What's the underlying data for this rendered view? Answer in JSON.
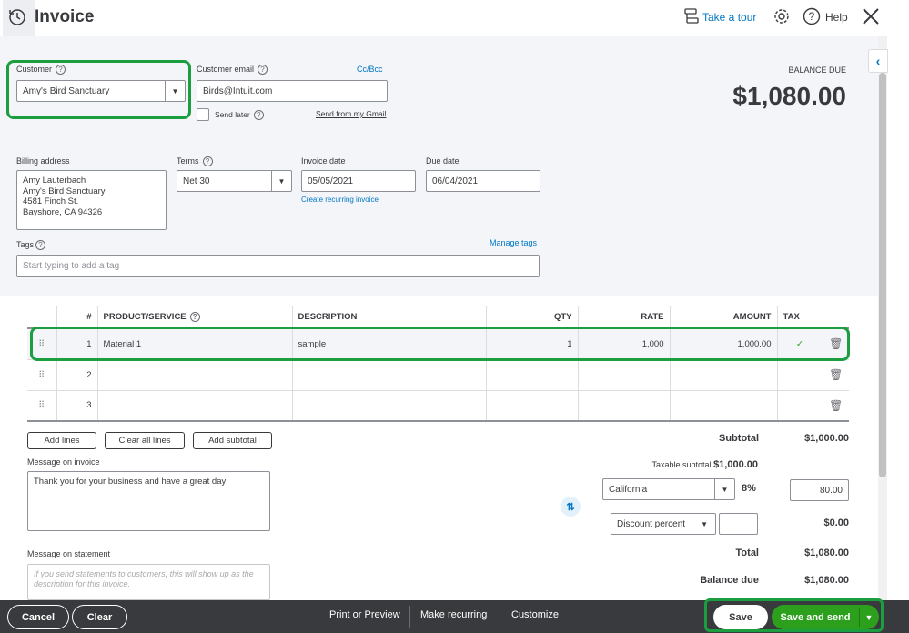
{
  "header": {
    "title": "Invoice",
    "take_a_tour": "Take a tour",
    "help": "Help"
  },
  "customer": {
    "label": "Customer",
    "value": "Amy's Bird Sanctuary",
    "email_label": "Customer email",
    "email_value": "Birds@Intuit.com",
    "ccbcc": "Cc/Bcc",
    "send_later": "Send later",
    "send_gmail": "Send from my Gmail"
  },
  "balance": {
    "label": "BALANCE DUE",
    "amount": "$1,080.00"
  },
  "billing": {
    "label": "Billing address",
    "lines": [
      "Amy Lauterbach",
      "Amy's Bird Sanctuary",
      "4581 Finch St.",
      "Bayshore, CA  94326"
    ]
  },
  "terms": {
    "label": "Terms",
    "value": "Net 30"
  },
  "invoice_date": {
    "label": "Invoice date",
    "value": "05/05/2021",
    "recurring_link": "Create recurring invoice"
  },
  "due_date": {
    "label": "Due date",
    "value": "06/04/2021"
  },
  "tags": {
    "label": "Tags",
    "manage": "Manage tags",
    "placeholder": "Start typing to add a tag"
  },
  "table": {
    "headers": {
      "num": "#",
      "product": "PRODUCT/SERVICE",
      "description": "DESCRIPTION",
      "qty": "QTY",
      "rate": "RATE",
      "amount": "AMOUNT",
      "tax": "TAX"
    },
    "rows": [
      {
        "num": "1",
        "product": "Material 1",
        "description": "sample",
        "qty": "1",
        "rate": "1,000",
        "amount": "1,000.00",
        "tax": "✓"
      },
      {
        "num": "2",
        "product": "",
        "description": "",
        "qty": "",
        "rate": "",
        "amount": "",
        "tax": ""
      },
      {
        "num": "3",
        "product": "",
        "description": "",
        "qty": "",
        "rate": "",
        "amount": "",
        "tax": ""
      }
    ]
  },
  "line_buttons": {
    "add_lines": "Add lines",
    "clear_all": "Clear all lines",
    "add_subtotal": "Add subtotal"
  },
  "message_invoice": {
    "label": "Message on invoice",
    "value": "Thank you for your business and have a great day!"
  },
  "message_statement": {
    "label": "Message on statement",
    "placeholder": "If you send statements to customers, this will show up as the description for this invoice."
  },
  "totals": {
    "subtotal_label": "Subtotal",
    "subtotal_value": "$1,000.00",
    "taxable_label": "Taxable subtotal",
    "taxable_value": "$1,000.00",
    "tax_region": "California",
    "tax_rate": "8%",
    "tax_amount": "80.00",
    "discount_type": "Discount percent",
    "discount_value": "$0.00",
    "total_label": "Total",
    "total_value": "$1,080.00",
    "balance_label": "Balance due",
    "balance_value": "$1,080.00"
  },
  "footer": {
    "cancel": "Cancel",
    "clear": "Clear",
    "print": "Print or Preview",
    "recurring": "Make recurring",
    "customize": "Customize",
    "save": "Save",
    "save_send": "Save and send"
  },
  "colors": {
    "accent": "#0077c5",
    "green": "#2ca01c",
    "highlight": "#1a9e3f",
    "footer": "#393a3d"
  }
}
